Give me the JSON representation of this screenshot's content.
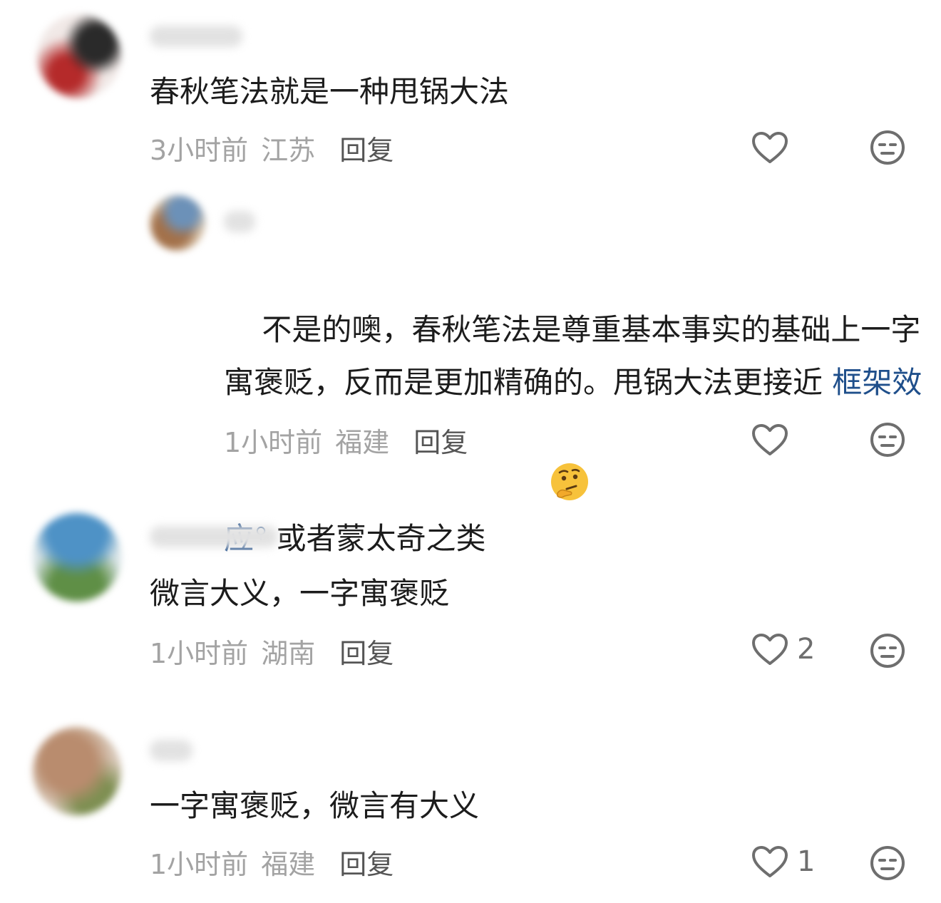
{
  "comments": [
    {
      "text": "春秋笔法就是一种甩锅大法",
      "time": "3小时前",
      "location": "江苏",
      "reply_label": "回复",
      "like_count": "",
      "replies": [
        {
          "text_before_link": "不是的噢，春秋笔法是尊重基本事实的基础上一字寓褒贬，反而是更加精确的。甩锅大法更接近 ",
          "link_text": "框架效应",
          "text_after_link": " 或者蒙太奇之类",
          "emoji": "thinking-face",
          "time": "1小时前",
          "location": "福建",
          "reply_label": "回复",
          "like_count": ""
        }
      ]
    },
    {
      "text": "微言大义，一字寓褒贬",
      "time": "1小时前",
      "location": "湖南",
      "reply_label": "回复",
      "like_count": "2"
    },
    {
      "text": "一字寓褒贬，微言有大义",
      "time": "1小时前",
      "location": "福建",
      "reply_label": "回复",
      "like_count": "1"
    }
  ],
  "icons": {
    "like": "heart-outline-icon",
    "dislike": "meh-face-icon",
    "search": "search-icon"
  },
  "colors": {
    "link": "#1f4f8b",
    "meta": "#a3a3a3",
    "icon": "#6e6e6e"
  }
}
